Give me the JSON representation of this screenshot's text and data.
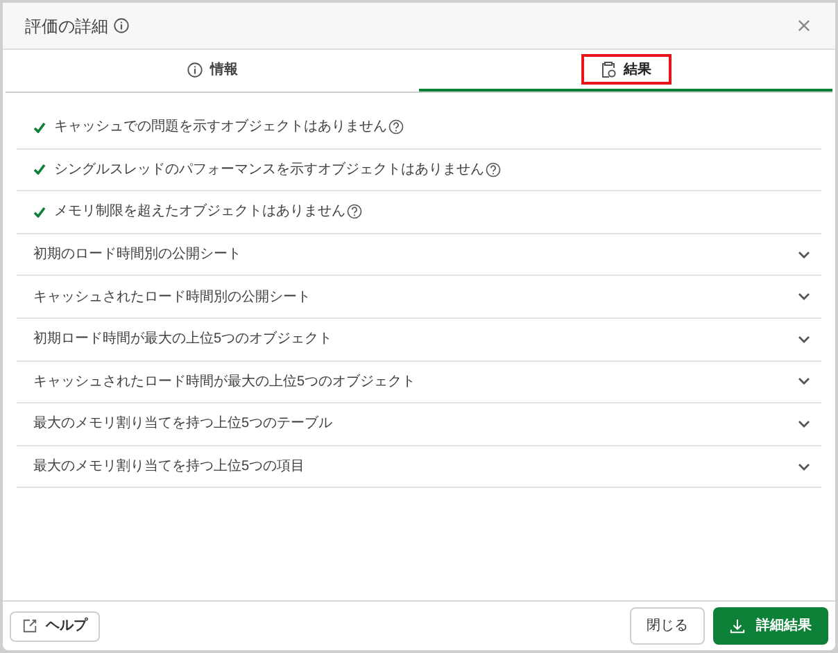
{
  "window": {
    "title": "評価の詳細"
  },
  "tabs": [
    {
      "label": "情報",
      "selected": false,
      "highlighted": false
    },
    {
      "label": "結果",
      "selected": true,
      "highlighted": true
    }
  ],
  "rows": [
    {
      "kind": "check",
      "label": "キャッシュでの問題を示すオブジェクトはありません"
    },
    {
      "kind": "check",
      "label": "シングルスレッドのパフォーマンスを示すオブジェクトはありません"
    },
    {
      "kind": "check",
      "label": "メモリ制限を超えたオブジェクトはありません"
    },
    {
      "kind": "section",
      "label": "初期のロード時間別の公開シート",
      "expanded": false
    },
    {
      "kind": "section",
      "label": "キャッシュされたロード時間別の公開シート",
      "expanded": false
    },
    {
      "kind": "section",
      "label": "初期ロード時間が最大の上位5つのオブジェクト",
      "expanded": false
    },
    {
      "kind": "section",
      "label": "キャッシュされたロード時間が最大の上位5つのオブジェクト",
      "expanded": false
    },
    {
      "kind": "section",
      "label": "最大のメモリ割り当てを持つ上位5つのテーブル",
      "expanded": false
    },
    {
      "kind": "section",
      "label": "最大のメモリ割り当てを持つ上位5つの項目",
      "expanded": false
    }
  ],
  "footer": {
    "help": "ヘルプ",
    "close": "閉じる",
    "details": "詳細結果"
  }
}
